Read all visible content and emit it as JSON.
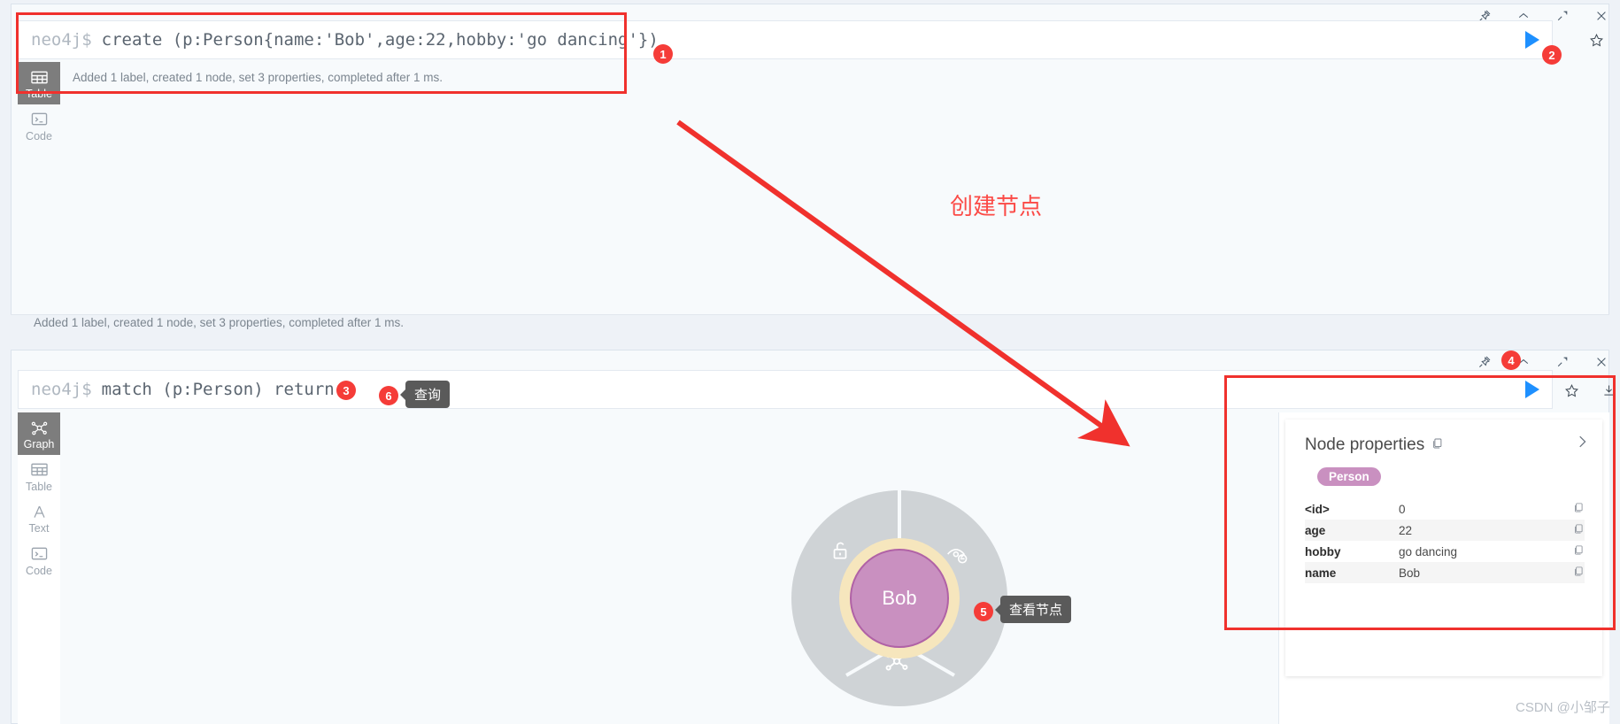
{
  "panel1": {
    "window_icons": [
      "pin-icon",
      "collapse-icon",
      "expand-icon",
      "close-icon"
    ],
    "editor": {
      "prompt": "neo4j$",
      "query": "create (p:Person{name:'Bob',age:22,hobby:'go dancing'})",
      "run_label": "run-query",
      "favorite_label": "favorite"
    },
    "result_text": "Added 1 label, created 1 node, set 3 properties, completed after 1 ms.",
    "status_text": "Added 1 label, created 1 node, set 3 properties, completed after 1 ms.",
    "views": [
      {
        "label": "Table",
        "icon": "table-icon",
        "active": true
      },
      {
        "label": "Code",
        "icon": "code-icon",
        "active": false
      }
    ]
  },
  "panel2": {
    "window_icons": [
      "pin-icon",
      "collapse-icon",
      "expand-icon",
      "close-icon"
    ],
    "editor": {
      "prompt": "neo4j$",
      "query": "match (p:Person) return p"
    },
    "views": [
      {
        "label": "Graph",
        "icon": "graph-icon",
        "active": true
      },
      {
        "label": "Table",
        "icon": "table-icon",
        "active": false
      },
      {
        "label": "Text",
        "icon": "text-icon",
        "active": false
      },
      {
        "label": "Code",
        "icon": "code-icon",
        "active": false
      }
    ],
    "graph": {
      "node_caption": "Bob",
      "node_color": "#c990c0",
      "halo_color": "#f6e6bd",
      "ring_color": "#cfd3d6",
      "ring_actions": [
        "unlock-icon",
        "hide-icon",
        "expand-node-icon"
      ]
    },
    "inspector": {
      "editor_prompt": "",
      "run_label": "run-query",
      "favorite_label": "favorite",
      "download_label": "download",
      "title": "Node properties",
      "copy_all_label": "copy-all",
      "label_pill": "Person",
      "rows": [
        {
          "key": "<id>",
          "value": "0"
        },
        {
          "key": "age",
          "value": "22"
        },
        {
          "key": "hobby",
          "value": "go dancing"
        },
        {
          "key": "name",
          "value": "Bob"
        }
      ]
    }
  },
  "annotations": {
    "badges": [
      {
        "n": "1"
      },
      {
        "n": "2"
      },
      {
        "n": "3"
      },
      {
        "n": "4"
      },
      {
        "n": "5"
      },
      {
        "n": "6"
      }
    ],
    "callout_create": "创建节点",
    "tip_query": "查询",
    "tip_view_node": "查看节点",
    "highlight_color": "#f0312d"
  },
  "watermark": "CSDN @小邹子"
}
